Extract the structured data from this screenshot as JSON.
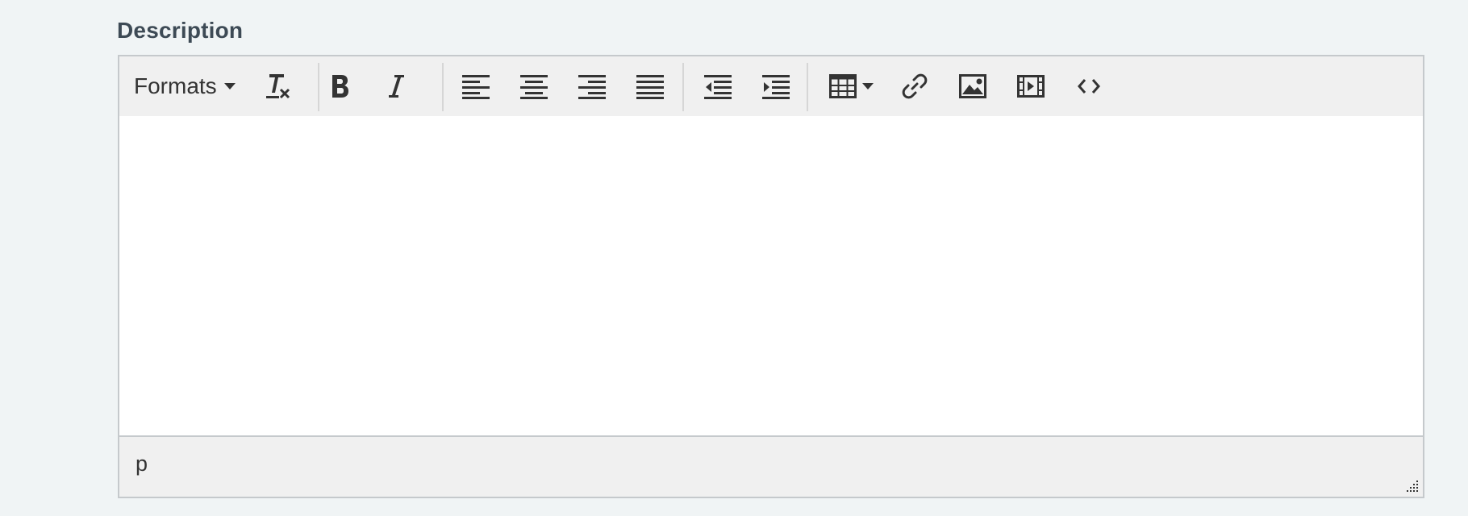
{
  "field": {
    "label": "Description"
  },
  "toolbar": {
    "formats_label": "Formats",
    "buttons": [
      {
        "name": "clear-formatting",
        "icon": "clear-format-icon"
      },
      {
        "name": "bold",
        "icon": "bold-icon"
      },
      {
        "name": "italic",
        "icon": "italic-icon"
      },
      {
        "name": "align-left",
        "icon": "align-left-icon"
      },
      {
        "name": "align-center",
        "icon": "align-center-icon"
      },
      {
        "name": "align-right",
        "icon": "align-right-icon"
      },
      {
        "name": "align-justify",
        "icon": "align-justify-icon"
      },
      {
        "name": "outdent",
        "icon": "outdent-icon"
      },
      {
        "name": "indent",
        "icon": "indent-icon"
      },
      {
        "name": "table",
        "icon": "table-icon"
      },
      {
        "name": "link",
        "icon": "link-icon"
      },
      {
        "name": "image",
        "icon": "image-icon"
      },
      {
        "name": "media",
        "icon": "film-icon"
      },
      {
        "name": "source-code",
        "icon": "code-icon"
      }
    ]
  },
  "editor": {
    "content": ""
  },
  "statusbar": {
    "path": "p"
  },
  "colors": {
    "page_bg": "#f0f4f5",
    "toolbar_bg": "#f0f0f0",
    "border": "#c5c9cc",
    "icon": "#333333",
    "label": "#3d4a55"
  }
}
